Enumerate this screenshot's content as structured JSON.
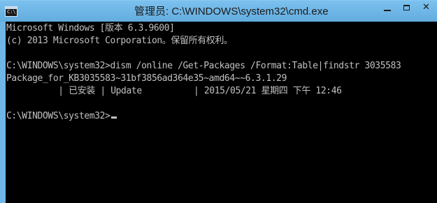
{
  "window": {
    "title": "管理员: C:\\WINDOWS\\system32\\cmd.exe",
    "icon_label": "C:\\",
    "controls": {
      "minimize_icon": "minimize-icon",
      "maximize_icon": "maximize-icon",
      "close_icon": "close-icon",
      "close_glyph": "✕"
    }
  },
  "console": {
    "lines": [
      "Microsoft Windows [版本 6.3.9600]",
      "(c) 2013 Microsoft Corporation。保留所有权利。",
      "",
      "C:\\WINDOWS\\system32>dism /online /Get-Packages /Format:Table|findstr 3035583",
      "Package_for_KB3035583~31bf3856ad364e35~amd64~~6.3.1.29",
      "          | 已安装 | Update          | 2015/05/21 星期四 下午 12:46",
      "",
      "C:\\WINDOWS\\system32>"
    ]
  },
  "colors": {
    "titlebar": "#6fb6e6",
    "console_bg": "#000000",
    "console_text": "#c0c0c0"
  }
}
